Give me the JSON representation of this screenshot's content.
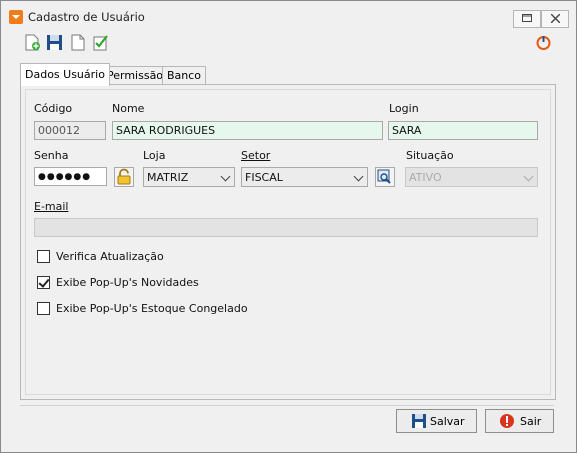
{
  "window": {
    "title": "Cadastro de Usuário"
  },
  "toolbar": {
    "icons": [
      "new-doc-icon",
      "save-icon",
      "copy-icon",
      "approve-icon"
    ],
    "right_icon": "power-icon"
  },
  "tabs": [
    {
      "label": "Dados Usuário",
      "active": true
    },
    {
      "label": "Permissão",
      "active": false
    },
    {
      "label": "Banco",
      "active": false
    }
  ],
  "form": {
    "codigo": {
      "label": "Código",
      "value": "000012"
    },
    "nome": {
      "label": "Nome",
      "value": "SARA RODRIGUES"
    },
    "login": {
      "label": "Login",
      "value": "SARA"
    },
    "senha": {
      "label": "Senha",
      "value": "●●●●●●"
    },
    "loja": {
      "label": "Loja",
      "value": "MATRIZ"
    },
    "setor": {
      "label": "Setor",
      "value": "FISCAL"
    },
    "situacao": {
      "label": "Situação",
      "value": "ATIVO"
    },
    "email": {
      "label": "E-mail",
      "value": ""
    }
  },
  "checkboxes": [
    {
      "label": "Verifica Atualização",
      "checked": false
    },
    {
      "label": "Exibe Pop-Up's Novidades",
      "checked": true
    },
    {
      "label": "Exibe Pop-Up's Estoque Congelado",
      "checked": false
    }
  ],
  "buttons": {
    "save": "Salvar",
    "exit": "Sair"
  },
  "colors": {
    "accent": "#f07d1b",
    "field_highlight": "#e6f7ee",
    "save_blue": "#1f4f8a",
    "exit_red": "#d9341c"
  }
}
